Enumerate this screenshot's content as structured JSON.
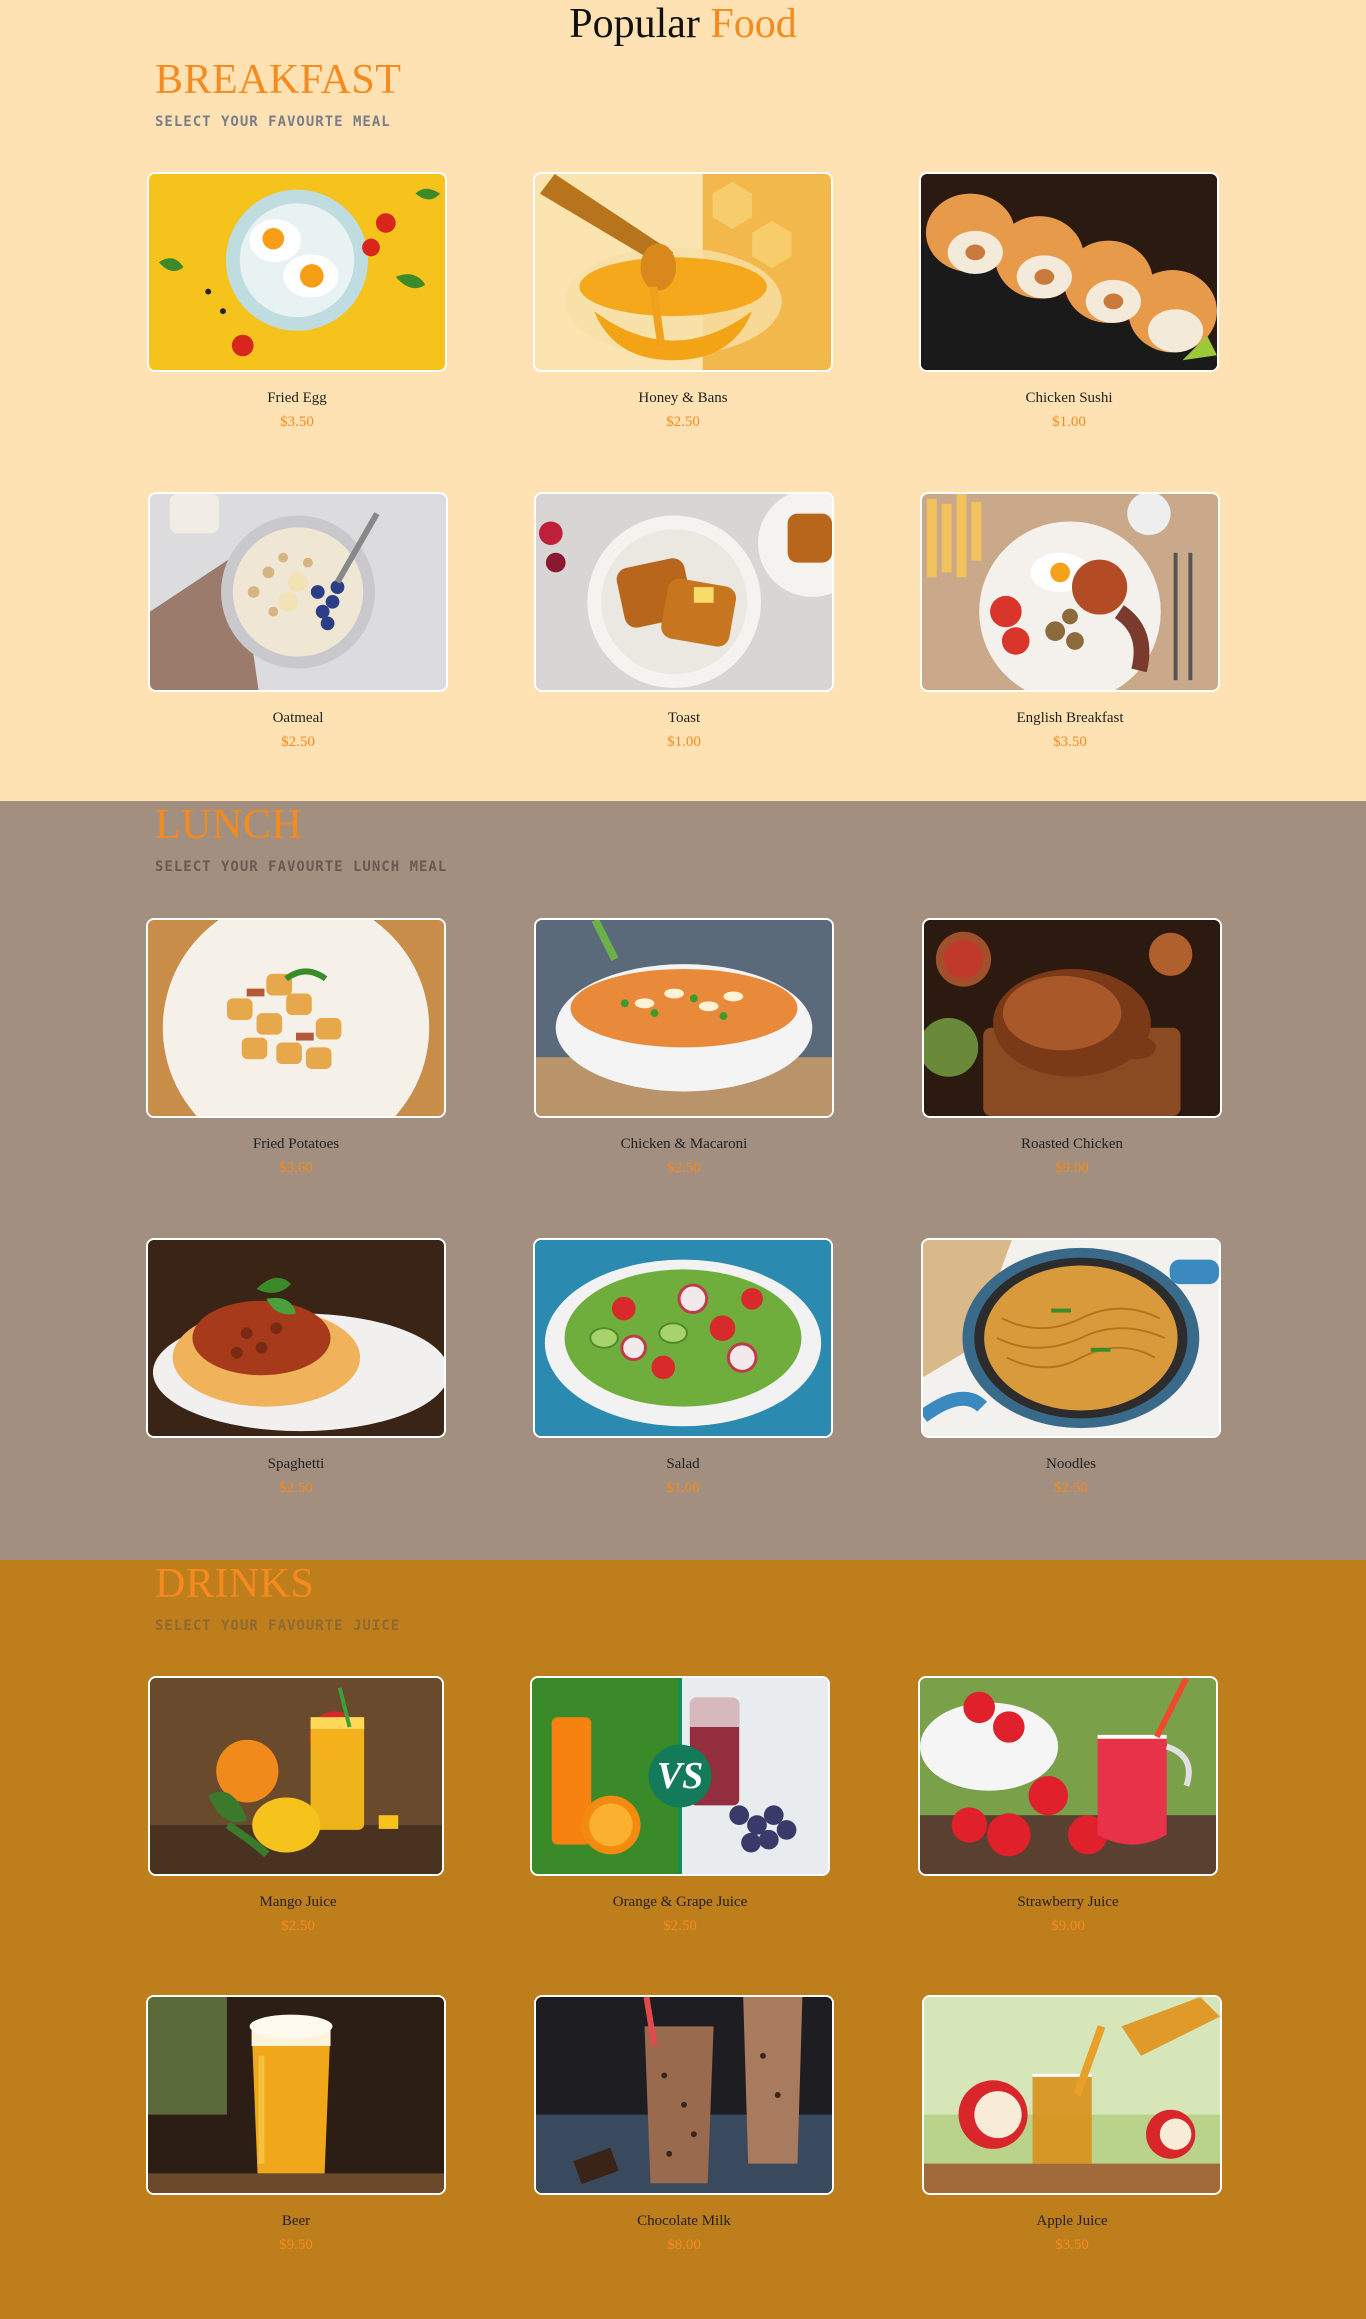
{
  "header": {
    "title_main": "Popular",
    "title_accent": "Food"
  },
  "colors": {
    "accent": "#f58a1f",
    "breakfast_bg": "#ffe2b3",
    "lunch_bg": "#a38f80",
    "drinks_bg": "#be7e1c"
  },
  "sections": [
    {
      "title": "BREAKFAST",
      "subtitle": "SELECT YOUR FAVOURTE MEAL",
      "items": [
        {
          "name": "Fried Egg",
          "price": "$3.50",
          "icon": "fried-egg-photo"
        },
        {
          "name": "Honey & Bans",
          "price": "$2.50",
          "icon": "honey-photo"
        },
        {
          "name": "Chicken Sushi",
          "price": "$1.00",
          "icon": "sushi-photo"
        },
        {
          "name": "Oatmeal",
          "price": "$2.50",
          "icon": "oatmeal-photo"
        },
        {
          "name": "Toast",
          "price": "$1.00",
          "icon": "toast-photo"
        },
        {
          "name": "English Breakfast",
          "price": "$3.50",
          "icon": "english-breakfast-photo"
        }
      ]
    },
    {
      "title": "LUNCH",
      "subtitle": "SELECT YOUR FAVOURTE LUNCH MEAL",
      "items": [
        {
          "name": "Fried Potatoes",
          "price": "$3.60",
          "icon": "fried-potatoes-photo"
        },
        {
          "name": "Chicken & Macaroni",
          "price": "$2.50",
          "icon": "macaroni-photo"
        },
        {
          "name": "Roasted Chicken",
          "price": "$9.00",
          "icon": "roasted-chicken-photo"
        },
        {
          "name": "Spaghetti",
          "price": "$2.50",
          "icon": "spaghetti-photo"
        },
        {
          "name": "Salad",
          "price": "$1.00",
          "icon": "salad-photo"
        },
        {
          "name": "Noodles",
          "price": "$2.50",
          "icon": "noodles-photo"
        }
      ]
    },
    {
      "title": "DRINKS",
      "subtitle": "SELECT YOUR FAVOURTE JUICE",
      "items": [
        {
          "name": "Mango Juice",
          "price": "$2.50",
          "icon": "mango-juice-photo"
        },
        {
          "name": "Orange & Grape Juice",
          "price": "$2.50",
          "icon": "orange-grape-juice-photo",
          "badge": "VS"
        },
        {
          "name": "Strawberry Juice",
          "price": "$9.00",
          "icon": "strawberry-juice-photo"
        },
        {
          "name": "Beer",
          "price": "$9.50",
          "icon": "beer-photo"
        },
        {
          "name": "Chocolate Milk",
          "price": "$8.00",
          "icon": "chocolate-milk-photo"
        },
        {
          "name": "Apple Juice",
          "price": "$3.50",
          "icon": "apple-juice-photo"
        }
      ]
    }
  ]
}
